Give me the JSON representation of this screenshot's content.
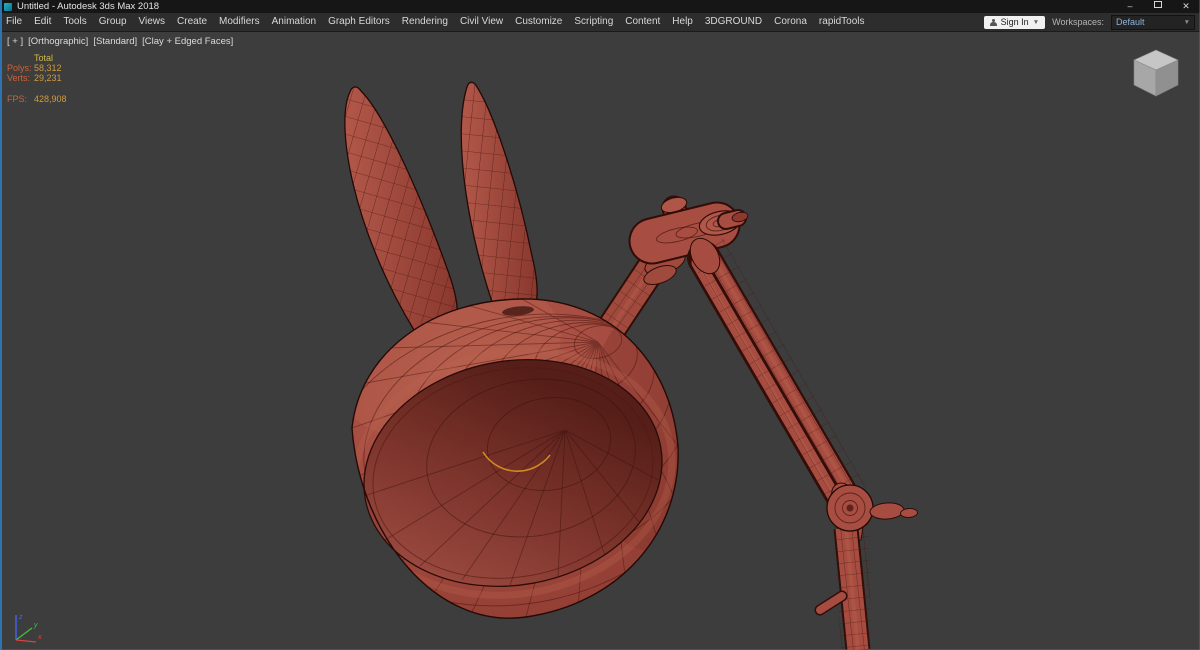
{
  "window": {
    "title": "Untitled - Autodesk 3ds Max 2018",
    "minimize_label": "–",
    "close_label": "✕"
  },
  "menubar": {
    "items": [
      "File",
      "Edit",
      "Tools",
      "Group",
      "Views",
      "Create",
      "Modifiers",
      "Animation",
      "Graph Editors",
      "Rendering",
      "Civil View",
      "Customize",
      "Scripting",
      "Content",
      "Help",
      "3DGROUND",
      "Corona",
      "rapidTools"
    ],
    "sign_in": "Sign In",
    "workspaces_label": "Workspaces:",
    "workspace_value": "Default"
  },
  "viewport": {
    "labels": [
      "[ + ]",
      "[Orthographic]",
      "[Standard]",
      "[Clay + Edged Faces]"
    ],
    "stats": {
      "total": "Total",
      "polys_label": "Polys:",
      "polys": "58,312",
      "verts_label": "Verts:",
      "verts": "29,231",
      "fps_label": "FPS:",
      "fps": "428,908"
    },
    "axis": {
      "x": "x",
      "y": "y",
      "z": "z"
    }
  },
  "colors": {
    "viewport_bg": "#3d3d3d",
    "titlebar_bg": "#161616",
    "menubar_bg": "#2d2d2d",
    "window_accent": "#2e74b5",
    "clay": "#a64c40",
    "clay_highlight": "#bb6351",
    "clay_deep": "#5f231d",
    "wireframe": "#45140e",
    "accent_spline": "#cf8a22",
    "stats_label": "#c9653a",
    "stats_value": "#cf9a3e",
    "workspace_text": "#8db3d6"
  }
}
